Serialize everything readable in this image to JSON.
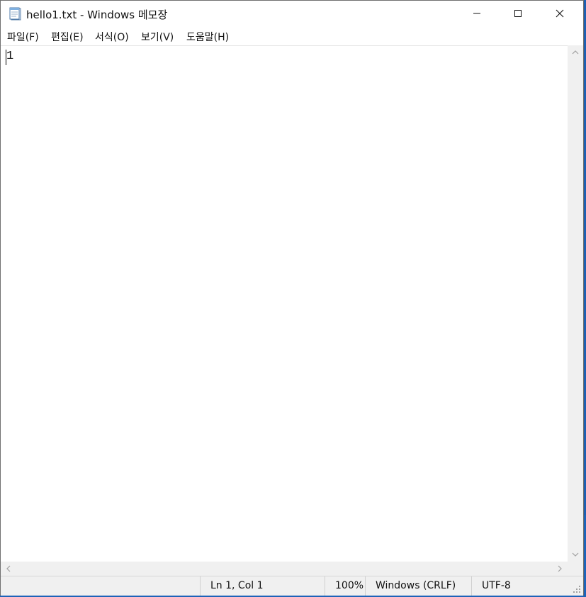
{
  "window": {
    "title": "hello1.txt - Windows 메모장",
    "app_icon": "notepad-icon",
    "controls": {
      "minimize_icon": "minimize-icon",
      "maximize_icon": "maximize-icon",
      "close_icon": "close-icon"
    }
  },
  "menu": {
    "items": [
      {
        "label": "파일(F)"
      },
      {
        "label": "편집(E)"
      },
      {
        "label": "서식(O)"
      },
      {
        "label": "보기(V)"
      },
      {
        "label": "도움말(H)"
      }
    ]
  },
  "editor": {
    "content": "1"
  },
  "statusbar": {
    "position": "Ln 1, Col 1",
    "zoom": "100%",
    "line_ending": "Windows (CRLF)",
    "encoding": "UTF-8"
  },
  "colors": {
    "desktop": "#1e63b8",
    "window_bg": "#ffffff",
    "chrome_bg": "#f0f0f0"
  }
}
